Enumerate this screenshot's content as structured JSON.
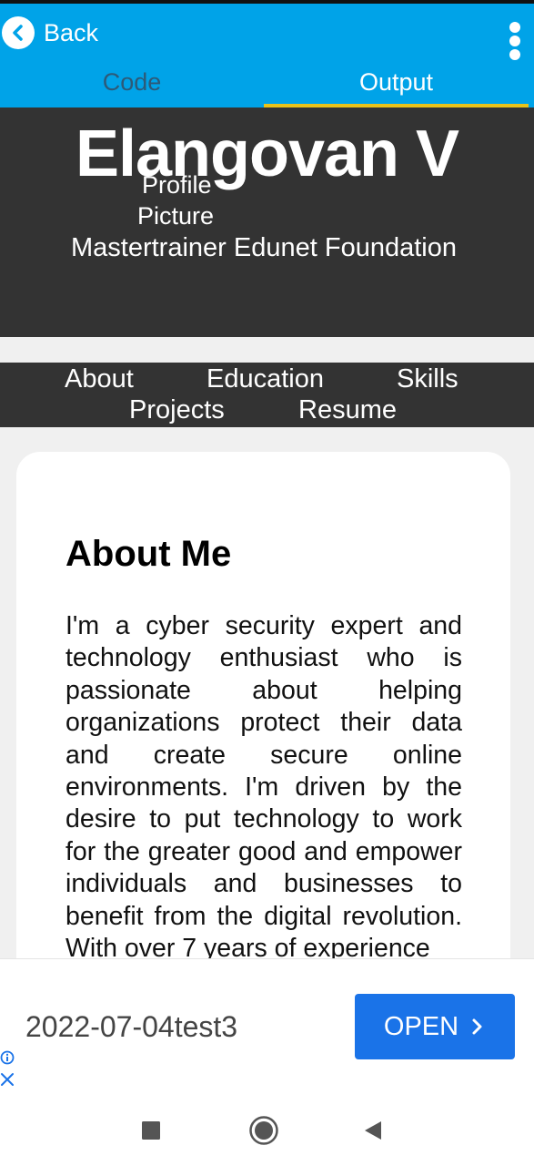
{
  "topbar": {
    "back_label": "Back",
    "tabs": [
      {
        "label": "Code"
      },
      {
        "label": "Output"
      }
    ]
  },
  "header": {
    "name": "Elangovan V",
    "picture_alt_line1": "Profile",
    "picture_alt_line2": "Picture",
    "job_title": "Mastertrainer Edunet Foundation"
  },
  "nav": {
    "items": [
      "About",
      "Education",
      "Skills",
      "Projects",
      "Resume"
    ]
  },
  "about": {
    "title": "About Me",
    "text": "I'm a cyber security expert and technology enthusiast who is passionate about helping organizations protect their data and create secure online environments. I'm driven by the desire to put technology to work for the greater good and empower individuals and businesses to benefit from the digital revolution. With over 7 years of experience"
  },
  "ad": {
    "text": "2022-07-04test3",
    "open_label": "OPEN"
  },
  "colors": {
    "topbar": "#00a3e8",
    "header": "#333333",
    "tab_indicator": "#e8c21a",
    "ad_button": "#1a73e8"
  },
  "icons": {
    "back": "chevron-left-icon",
    "menu": "more-vert-icon",
    "ad_info": "info-icon",
    "ad_close": "close-icon",
    "nav_recents": "square-icon",
    "nav_home": "circle-icon",
    "nav_back": "triangle-back-icon"
  }
}
